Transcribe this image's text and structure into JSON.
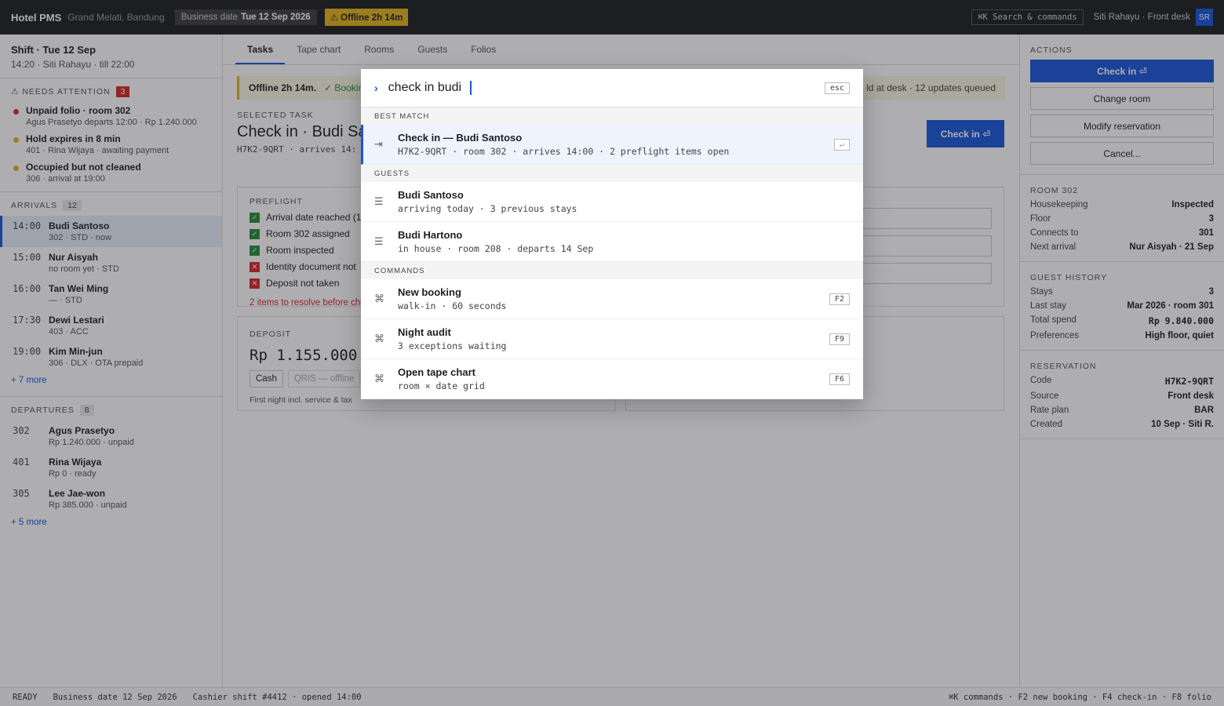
{
  "topbar": {
    "brand": "Hotel PMS",
    "property": "Grand Melati, Bandung",
    "bizdate_label": "Business date",
    "bizdate_value": "Tue 12 Sep 2026",
    "offline": "⚠ Offline 2h 14m",
    "search": "⌘K Search & commands",
    "user": "Siti Rahayu · Front desk",
    "avatar": "SR"
  },
  "shift": {
    "title": "Shift · Tue 12 Sep",
    "sub": "14:20 · Siti Rahayu · till 22:00"
  },
  "attention": {
    "label": "⚠ NEEDS ATTENTION",
    "count": "3",
    "items": [
      {
        "title": "Unpaid folio · room 302",
        "sub": "Agus Prasetyo departs 12:00 · Rp 1.240.000",
        "color": "#d62828"
      },
      {
        "title": "Hold expires in 8 min",
        "sub": "401 · Rina Wijaya · awaiting payment",
        "color": "#e3b51c"
      },
      {
        "title": "Occupied but not cleaned",
        "sub": "306 · arrival at 19:00",
        "color": "#e3b51c"
      }
    ]
  },
  "arrivals": {
    "label": "ARRIVALS",
    "count": "12",
    "items": [
      {
        "time": "14:00",
        "name": "Budi Santoso",
        "sub": "302 · STD · now"
      },
      {
        "time": "15:00",
        "name": "Nur Aisyah",
        "sub": "no room yet · STD"
      },
      {
        "time": "16:00",
        "name": "Tan Wei Ming",
        "sub": "— · STD"
      },
      {
        "time": "17:30",
        "name": "Dewi Lestari",
        "sub": "403 · ACC"
      },
      {
        "time": "19:00",
        "name": "Kim Min-jun",
        "sub": "306 · DLX · OTA prepaid"
      }
    ],
    "more": "+ 7 more"
  },
  "departures": {
    "label": "DEPARTURES",
    "count": "8",
    "items": [
      {
        "time": "302",
        "name": "Agus Prasetyo",
        "sub": "Rp 1.240.000 · unpaid"
      },
      {
        "time": "401",
        "name": "Rina Wijaya",
        "sub": "Rp 0 · ready"
      },
      {
        "time": "305",
        "name": "Lee Jae-won",
        "sub": "Rp 385.000 · unpaid"
      }
    ],
    "more": "+ 5 more"
  },
  "tabs": [
    "Tasks",
    "Tape chart",
    "Rooms",
    "Guests",
    "Folios"
  ],
  "banner": {
    "bold": "Offline 2h 14m.",
    "ok": "✓ Bookin",
    "right": "ld at desk · 12 updates queued"
  },
  "task": {
    "label": "SELECTED TASK",
    "title": "Check in · Budi Sa",
    "sub": "H7K2-9QRT · arrives 14:",
    "button": "Check in ⏎"
  },
  "preflight": {
    "label": "PREFLIGHT",
    "items": [
      {
        "text": "Arrival date reached (1",
        "ok": true
      },
      {
        "text": "Room 302 assigned",
        "ok": true
      },
      {
        "text": "Room inspected",
        "ok": true
      },
      {
        "text": "Identity document not",
        "ok": false
      },
      {
        "text": "Deposit not taken",
        "ok": false
      }
    ],
    "warning": "2 items to resolve before che"
  },
  "deposit": {
    "label": "DEPOSIT",
    "amount": "Rp 1.155.000",
    "pay": [
      "Cash",
      "QRIS — offline"
    ],
    "note": "First night incl. service & tax"
  },
  "actions": {
    "label": "ACTIONS",
    "buttons": [
      "Check in ⏎",
      "Change room",
      "Modify reservation",
      "Cancel..."
    ]
  },
  "room": {
    "label": "ROOM 302",
    "rows": [
      [
        "Housekeeping",
        "Inspected"
      ],
      [
        "Floor",
        "3"
      ],
      [
        "Connects to",
        "301"
      ],
      [
        "Next arrival",
        "Nur Aisyah · 21 Sep"
      ]
    ]
  },
  "history": {
    "label": "GUEST HISTORY",
    "rows": [
      [
        "Stays",
        "3"
      ],
      [
        "Last stay",
        "Mar 2026 · room 301"
      ],
      [
        "Total spend",
        "Rp 9.840.000"
      ],
      [
        "Preferences",
        "High floor, quiet"
      ]
    ]
  },
  "reservation": {
    "label": "RESERVATION",
    "rows": [
      [
        "Code",
        "H7K2-9QRT"
      ],
      [
        "Source",
        "Front desk"
      ],
      [
        "Rate plan",
        "BAR"
      ],
      [
        "Created",
        "10 Sep · Siti R."
      ]
    ]
  },
  "status": {
    "ready": "READY",
    "bizdate": "Business date 12 Sep 2026",
    "shift": "Cashier shift #4412 · opened 14:00",
    "hints": "⌘K commands · F2 new booking · F4 check-in · F8 folio"
  },
  "palette": {
    "prompt": "›",
    "query": "check in budi",
    "esc": "esc",
    "groups": [
      {
        "label": "BEST MATCH",
        "items": [
          {
            "icon": "⇥",
            "title": "Check in — Budi Santoso",
            "sub": "H7K2-9QRT · room 302 · arrives 14:00 · 2 preflight items open",
            "key": "↵",
            "active": true
          }
        ]
      },
      {
        "label": "GUESTS",
        "items": [
          {
            "icon": "☰",
            "title": "Budi Santoso",
            "sub": "arriving today · 3 previous stays",
            "key": ""
          },
          {
            "icon": "☰",
            "title": "Budi Hartono",
            "sub": "in house · room 208 · departs 14 Sep",
            "key": ""
          }
        ]
      },
      {
        "label": "COMMANDS",
        "items": [
          {
            "icon": "⌘",
            "title": "New booking",
            "sub": "walk-in · 60 seconds",
            "key": "F2"
          },
          {
            "icon": "⌘",
            "title": "Night audit",
            "sub": "3 exceptions waiting",
            "key": "F9"
          },
          {
            "icon": "⌘",
            "title": "Open tape chart",
            "sub": "room × date grid",
            "key": "F6"
          }
        ]
      }
    ]
  }
}
